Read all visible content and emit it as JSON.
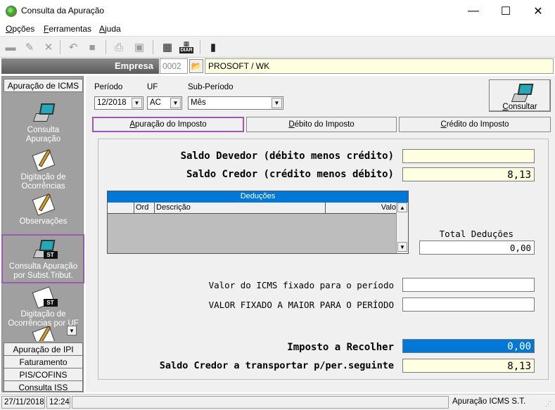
{
  "window": {
    "title": "Consulta da Apuração",
    "minimize": "—",
    "maximize": "☐",
    "close": "✕"
  },
  "menu": [
    {
      "accel": "O",
      "rest": "pções"
    },
    {
      "accel": "F",
      "rest": "erramentas"
    },
    {
      "accel": "A",
      "rest": "juda"
    }
  ],
  "toolbar": {
    "icons": [
      "new-icon",
      "edit-icon",
      "delete-icon",
      "undo-icon",
      "stop-icon",
      "print-icon",
      "export-icon",
      "calculator-icon",
      "daily-calculator-icon",
      "exit-door-icon"
    ],
    "daily_badge": "DIAR"
  },
  "empresa": {
    "label": "Empresa",
    "code": "0002",
    "name": "PROSOFT / WK"
  },
  "sidebar": {
    "top_group": "Apuração de ICMS",
    "items": [
      {
        "line1": "Consulta",
        "line2": "Apuração"
      },
      {
        "line1": "Digitação de",
        "line2": "Ocorrências"
      },
      {
        "line1": "Observações",
        "line2": ""
      },
      {
        "line1": "Consulta  Apuração",
        "line2": "por Subst.Tribut."
      },
      {
        "line1": "Digitação de",
        "line2": "Ocorrências por UF"
      }
    ],
    "badge_st": "ST",
    "bottom_groups": [
      "Apuração de IPI",
      "Faturamento",
      "PIS/COFINS",
      "Consulta ISS"
    ]
  },
  "filters": {
    "periodo_label": "Período",
    "periodo_value": "12/2018",
    "uf_label": "UF",
    "uf_value": "AC",
    "subperiodo_label": "Sub-Período",
    "subperiodo_value": "Mês"
  },
  "consultar": {
    "accel": "C",
    "rest": "onsultar"
  },
  "tabs": [
    {
      "accel": "A",
      "rest": "puração do Imposto"
    },
    {
      "accel": "D",
      "rest": "ébito do Imposto"
    },
    {
      "accel": "C",
      "rest": "rédito do Imposto"
    }
  ],
  "apuracao": {
    "saldo_devedor_label": "Saldo Devedor (débito menos crédito)",
    "saldo_devedor_value": "",
    "saldo_credor_label": "Saldo Credor (crédito menos débito)",
    "saldo_credor_value": "8,13",
    "deducoes_title": "Deduções",
    "deducoes_columns": [
      "",
      "Ord",
      "Descrição",
      "Valo"
    ],
    "total_deducoes_label": "Total Deduções",
    "total_deducoes_value": "0,00",
    "icms_fixado_label": "Valor do ICMS fixado para o período",
    "icms_fixado_value": "",
    "fixado_maior_label": "VALOR FIXADO A MAIOR PARA O PERÍODO",
    "fixado_maior_value": "",
    "imposto_recolher_label": "Imposto a Recolher",
    "imposto_recolher_value": "0,00",
    "saldo_transportar_label": "Saldo Credor a transportar p/per.seguinte",
    "saldo_transportar_value": "8,13"
  },
  "status": {
    "date": "27/11/2018",
    "time": "12:24",
    "module": "Apuração ICMS S.T."
  },
  "colors": {
    "highlight": "#9b59b6",
    "selection_blue": "#0078d7",
    "readonly_yellow": "#ffffe1",
    "sidebar_gray": "#a0a0a0"
  }
}
